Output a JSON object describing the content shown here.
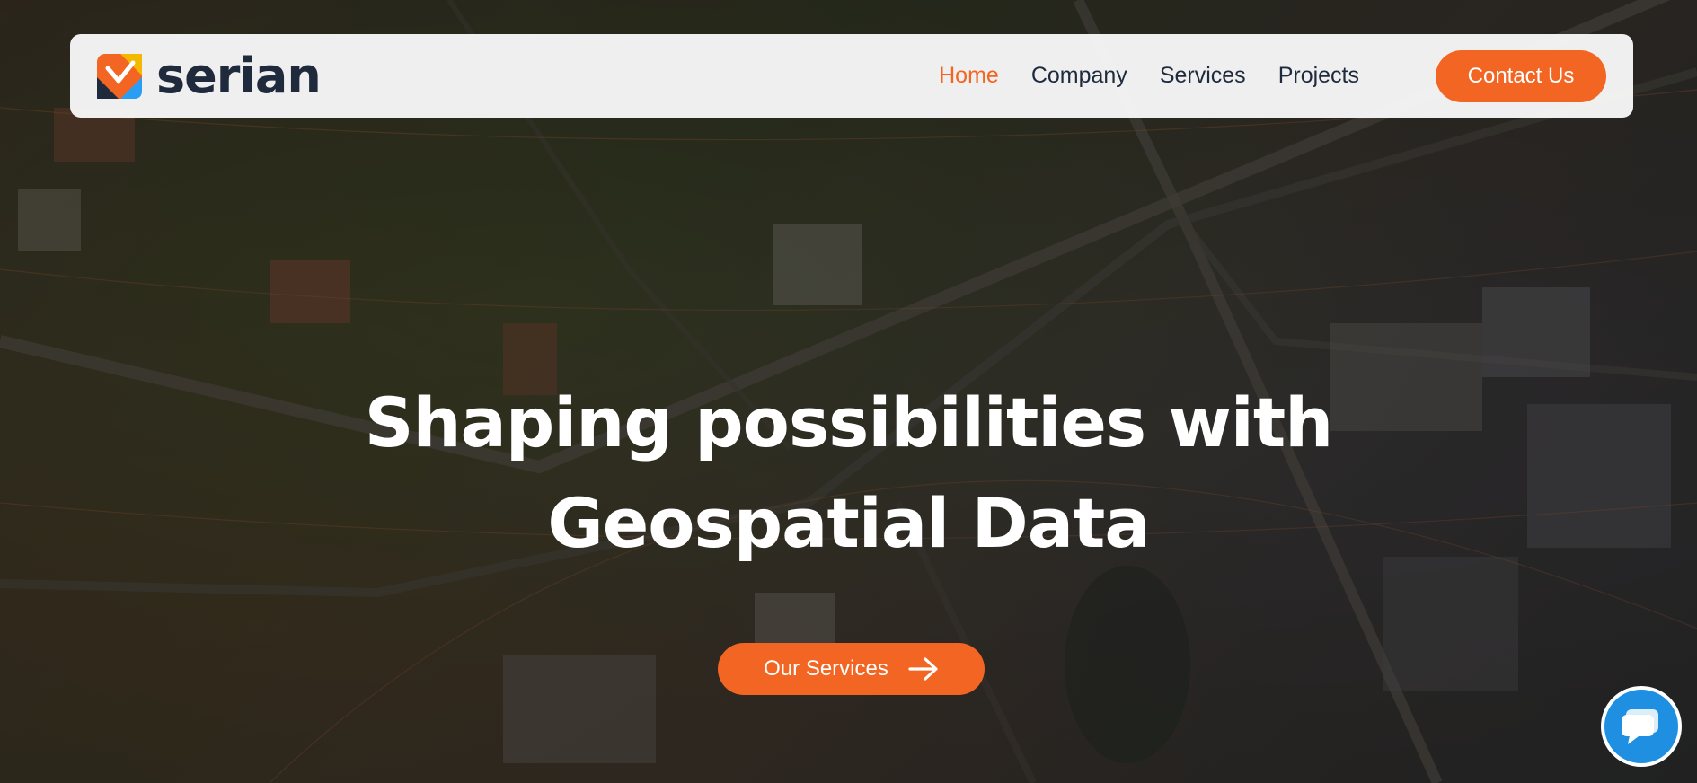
{
  "brand": {
    "name": "serian"
  },
  "nav": {
    "items": [
      {
        "label": "Home",
        "active": true
      },
      {
        "label": "Company",
        "active": false
      },
      {
        "label": "Services",
        "active": false
      },
      {
        "label": "Projects",
        "active": false
      }
    ],
    "contact_label": "Contact Us"
  },
  "hero": {
    "headline_line1": "Shaping possibilities with",
    "headline_line2": "Geospatial Data",
    "cta_label": "Our Services"
  },
  "colors": {
    "accent": "#f26522",
    "text_dark": "#1f2b3d",
    "chat": "#1e8fe1",
    "logo_blue": "#2a9df4",
    "logo_yellow": "#f5b800"
  },
  "icons": {
    "cta": "arrow-right-icon",
    "chat": "chat-bubble-icon",
    "logo": "serian-logo-mark"
  }
}
